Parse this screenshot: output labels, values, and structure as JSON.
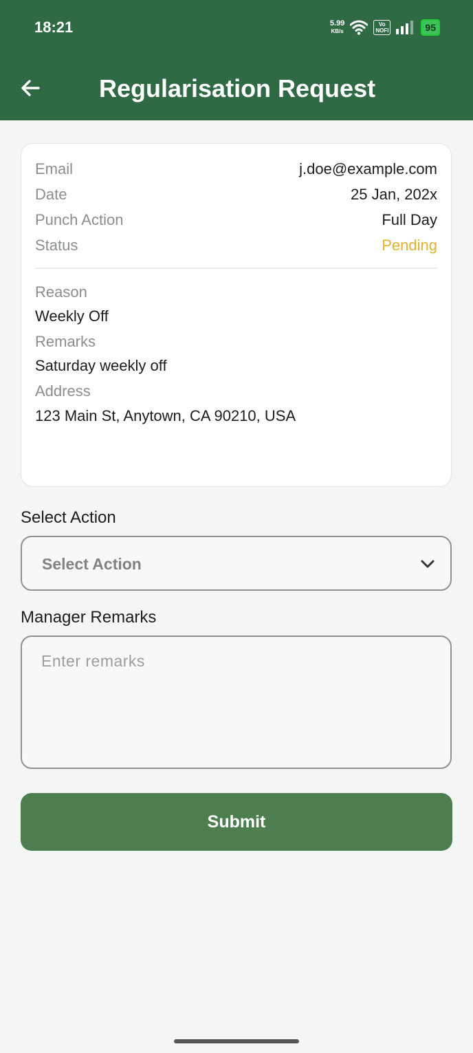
{
  "status_bar": {
    "time": "18:21",
    "net_speed": "5.99",
    "net_unit": "KB/s",
    "volte_top": "Vo",
    "volte_bottom": "NOFI",
    "battery": "95"
  },
  "header": {
    "title": "Regularisation Request"
  },
  "details": {
    "email_label": "Email",
    "email_value": "j.doe@example.com",
    "date_label": "Date",
    "date_value": "25 Jan, 202x",
    "punch_label": "Punch Action",
    "punch_value": "Full Day",
    "status_label": "Status",
    "status_value": "Pending",
    "reason_label": "Reason",
    "reason_value": "Weekly Off",
    "remarks_label": "Remarks",
    "remarks_value": "Saturday weekly off",
    "address_label": "Address",
    "address_value": "123 Main St, Anytown, CA 90210, USA"
  },
  "form": {
    "select_action_label": "Select Action",
    "select_action_value": "Select Action",
    "manager_remarks_label": "Manager Remarks",
    "manager_remarks_placeholder": "Enter remarks",
    "submit_label": "Submit"
  },
  "colors": {
    "header_bg": "#2f6a45",
    "submit_bg": "#4c7e4f",
    "pending": "#e3b22a"
  }
}
